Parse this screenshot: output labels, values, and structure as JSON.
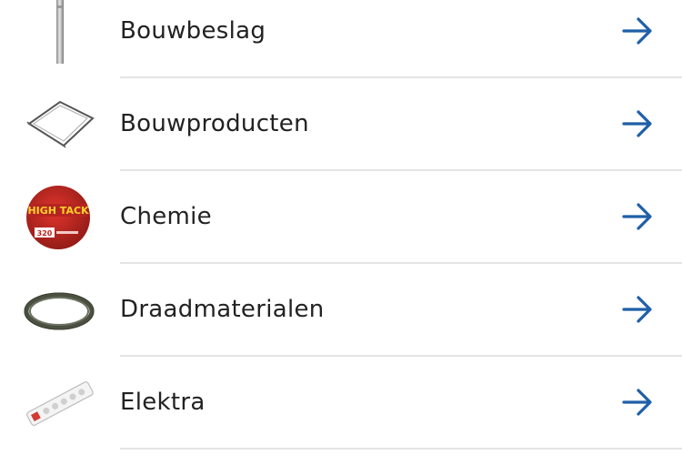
{
  "categories": [
    {
      "label": "Bouwbeslag",
      "thumb": "steel-rod-thumbnail",
      "arrow": "arrow-right-icon"
    },
    {
      "label": "Bouwproducten",
      "thumb": "frame-thumbnail",
      "arrow": "arrow-right-icon"
    },
    {
      "label": "Chemie",
      "thumb": "high-tack-can-thumbnail",
      "arrow": "arrow-right-icon"
    },
    {
      "label": "Draadmaterialen",
      "thumb": "wire-coil-thumbnail",
      "arrow": "arrow-right-icon"
    },
    {
      "label": "Elektra",
      "thumb": "power-strip-thumbnail",
      "arrow": "arrow-right-icon"
    }
  ],
  "thumb_text": {
    "chemie_brand": "HIGH TACK",
    "chemie_code": "320"
  },
  "colors": {
    "arrow": "#1f5fa8",
    "text": "#222222",
    "divider": "#e4e4e4",
    "background": "#ffffff"
  }
}
